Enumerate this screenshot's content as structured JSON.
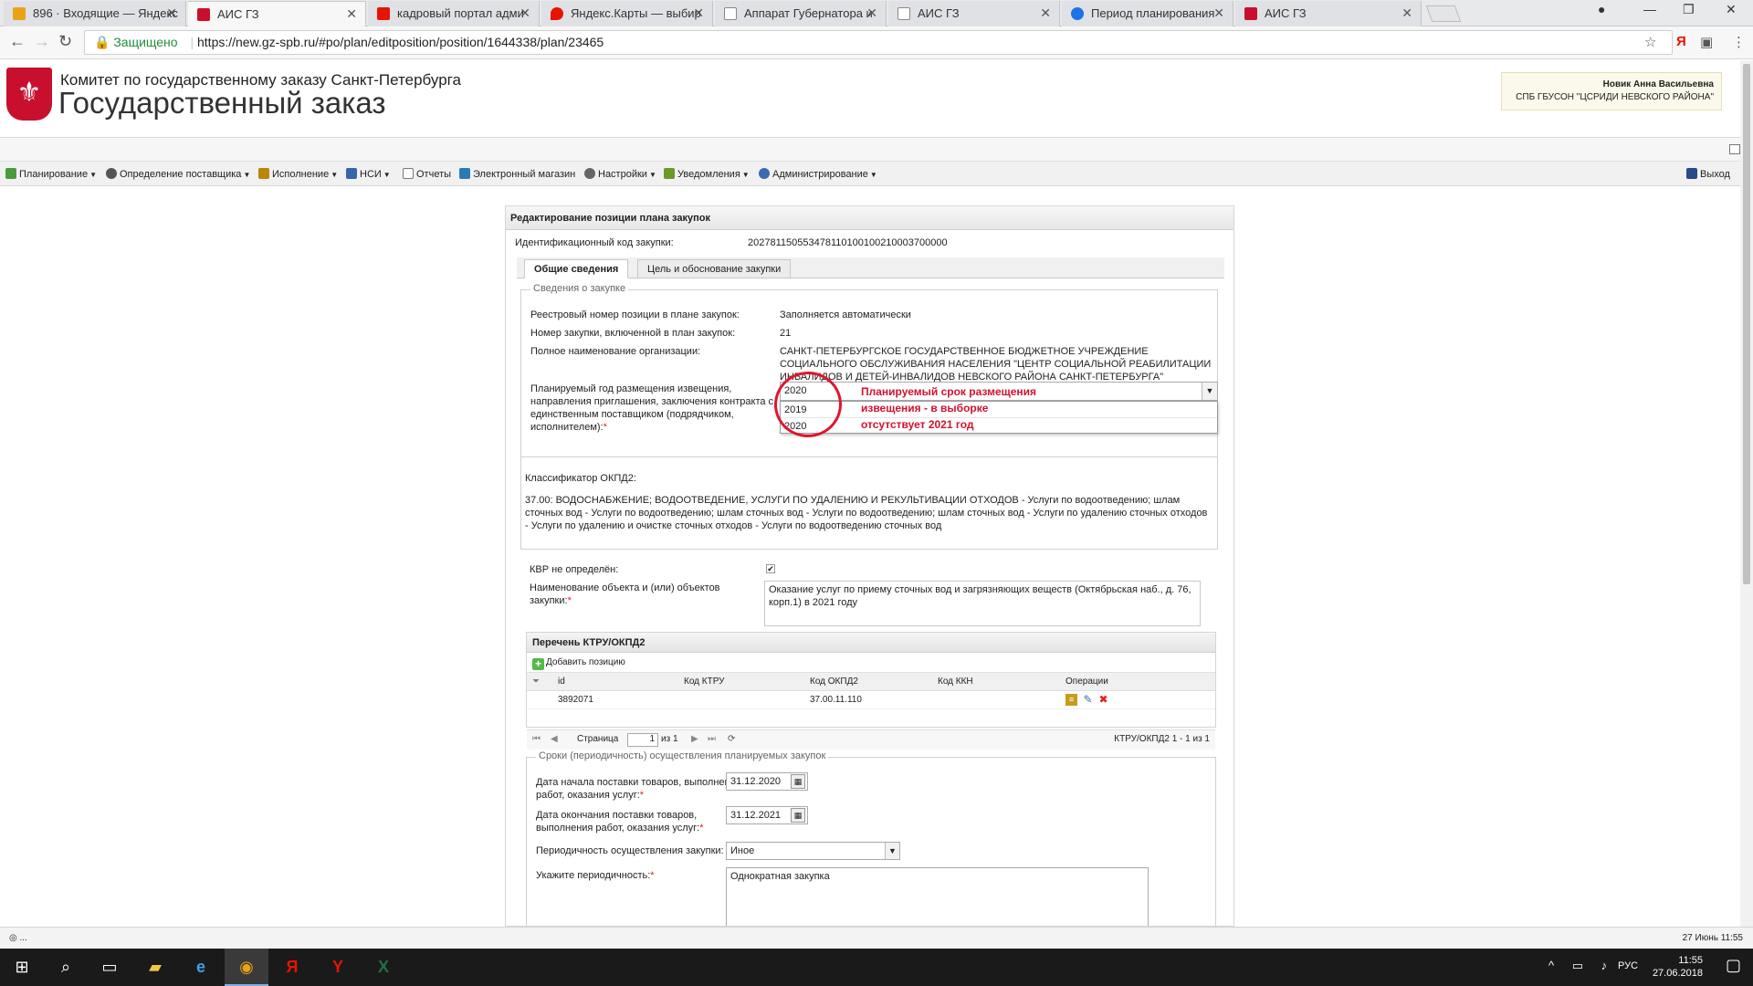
{
  "browser": {
    "tabs": [
      {
        "title": "896 · Входящие — Яндекс",
        "icon": "mail-icon",
        "color": "#e8a317"
      },
      {
        "title": "АИС ГЗ",
        "icon": "ais-icon",
        "color": "#c8102e"
      },
      {
        "title": "кадровый портал адми",
        "icon": "yandex-icon",
        "color": "#e61400"
      },
      {
        "title": "Яндекс.Карты — выбир",
        "icon": "maps-icon",
        "color": "#e61400"
      },
      {
        "title": "Аппарат Губернатора и",
        "icon": "page-icon",
        "color": "#888888"
      },
      {
        "title": "АИС ГЗ",
        "icon": "page-icon",
        "color": "#888888"
      },
      {
        "title": "Период планирования",
        "icon": "globe-icon",
        "color": "#1a73e8"
      },
      {
        "title": "АИС ГЗ",
        "icon": "ais-icon",
        "color": "#c8102e"
      }
    ],
    "secure_label": "Защищено",
    "url": "https://new.gz-spb.ru/#po/plan/editposition/position/1644338/plan/23465"
  },
  "header": {
    "org_line": "Комитет по государственному заказу Санкт-Петербурга",
    "title": "Государственный заказ",
    "user_name": "Новик Анна Васильевна",
    "user_org": "СПБ ГБУСОН \"ЦСРИДИ НЕВСКОГО РАЙОНА\""
  },
  "menu": {
    "items": [
      {
        "label": "Планирование",
        "icon": "planning-icon",
        "color": "#4a9b3c",
        "caret": true
      },
      {
        "label": "Определение поставщика",
        "icon": "supplier-icon",
        "color": "#555555",
        "caret": true
      },
      {
        "label": "Исполнение",
        "icon": "execution-icon",
        "color": "#b8860b",
        "caret": true
      },
      {
        "label": "НСИ",
        "icon": "nsi-icon",
        "color": "#3366aa",
        "caret": true
      },
      {
        "label": "Отчеты",
        "icon": "reports-icon",
        "color": "#777777",
        "caret": false
      },
      {
        "label": "Электронный магазин",
        "icon": "shop-icon",
        "color": "#2a7ab8",
        "caret": false
      },
      {
        "label": "Настройки",
        "icon": "settings-icon",
        "color": "#666666",
        "caret": true
      },
      {
        "label": "Уведомления",
        "icon": "notifications-icon",
        "color": "#6a9a2a",
        "caret": true
      },
      {
        "label": "Администрирование",
        "icon": "admin-icon",
        "color": "#3a6ab0",
        "caret": true
      }
    ],
    "logout": "Выход"
  },
  "form": {
    "panel_title": "Редактирование позиции плана закупок",
    "ident_label": "Идентификационный код закупки:",
    "ident_value": "202781150553478110100100210003700000",
    "tabs": [
      "Общие сведения",
      "Цель и обоснование закупки"
    ],
    "section_title": "Сведения о закупке",
    "reg_num_label": "Реестровый номер позиции в плане закупок:",
    "reg_num_value": "Заполняется автоматически",
    "purchase_num_label": "Номер закупки, включенной в план закупок:",
    "purchase_num_value": "21",
    "org_name_label": "Полное наименование организации:",
    "org_name_value": "САНКТ-ПЕТЕРБУРГСКОЕ ГОСУДАРСТВЕННОЕ БЮДЖЕТНОЕ УЧРЕЖДЕНИЕ СОЦИАЛЬНОГО ОБСЛУЖИВАНИЯ НАСЕЛЕНИЯ \"ЦЕНТР СОЦИАЛЬНОЙ РЕАБИЛИТАЦИИ ИНВАЛИДОВ И ДЕТЕЙ-ИНВАЛИДОВ НЕВСКОГО РАЙОНА САНКТ-ПЕТЕРБУРГА\"",
    "year_label": "Планируемый год размещения извещения, направления приглашения, заключения контракта с единственным поставщиком (подрядчиком, исполнителем):",
    "year_value": "2020",
    "year_options": [
      "2019",
      "2020"
    ],
    "annotation_line1": "Планируемый срок размещения",
    "annotation_line2": "извещения - в выборке",
    "annotation_line3": "отсутствует 2021 год",
    "okpd_label": "Классификатор ОКПД2:",
    "okpd_value": "37.00: ВОДОСНАБЖЕНИЕ; ВОДООТВЕДЕНИЕ, УСЛУГИ ПО УДАЛЕНИЮ И РЕКУЛЬТИВАЦИИ ОТХОДОВ - Услуги по водоотведению; шлам сточных вод - Услуги по водоотведению; шлам сточных вод - Услуги по водоотведению; шлам сточных вод - Услуги по удалению сточных отходов - Услуги по удалению и очистке сточных отходов - Услуги по водоотведению сточных вод",
    "kvr_label": "КВР не определён:",
    "kvr_checked": true,
    "object_label": "Наименование объекта и (или) объектов закупки:",
    "object_value": "Оказание услуг по приему сточных вод и загрязняющих веществ (Октябрьская наб., д. 76, корп.1) в 2021 году",
    "grid": {
      "title": "Перечень КТРУ/ОКПД2",
      "add_label": "Добавить позицию",
      "columns": [
        "id",
        "Код КТРУ",
        "Код ОКПД2",
        "Код ККН",
        "Операции"
      ],
      "rows": [
        {
          "id": "3892071",
          "ktru": "",
          "okpd2": "37.00.11.110",
          "kkn": ""
        }
      ],
      "page_label": "Страница",
      "page_value": "1",
      "page_of": "из 1",
      "summary": "КТРУ/ОКПД2 1 - 1 из 1"
    },
    "terms_title": "Сроки (периодичность) осуществления планируемых закупок",
    "start_label": "Дата начала поставки товаров, выполнения работ, оказания услуг:",
    "start_value": "31.12.2020",
    "end_label": "Дата окончания поставки товаров, выполнения работ, оказания услуг:",
    "end_value": "31.12.2021",
    "period_label": "Периодичность осуществления закупки:",
    "period_value": "Иное",
    "period_specify_label": "Укажите периодичность:",
    "period_specify_value": "Однократная закупка"
  },
  "status": {
    "left": "◎ ...",
    "datetime": "27 Июнь 11:55"
  },
  "taskbar": {
    "lang": "РУС",
    "time": "11:55",
    "date": "27.06.2018"
  }
}
